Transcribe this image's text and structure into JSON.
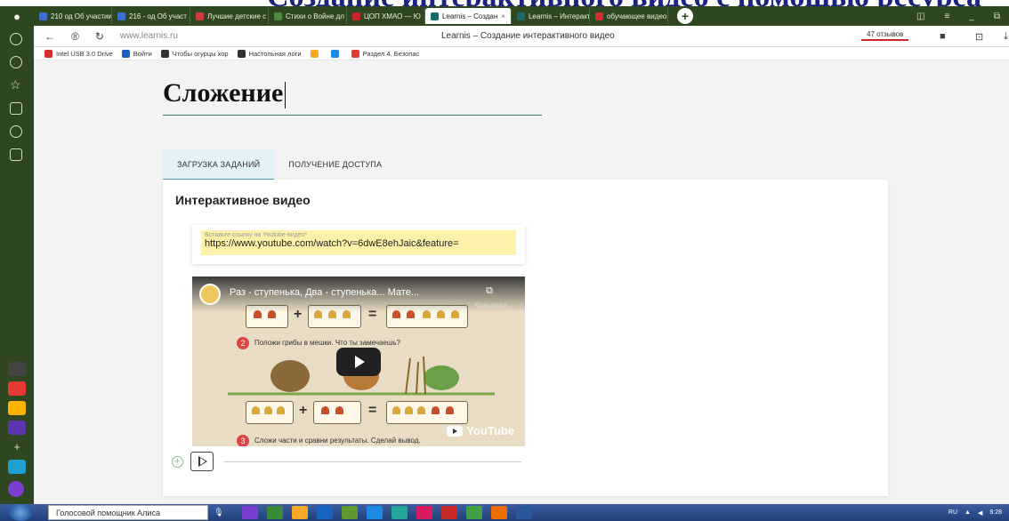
{
  "slide_header": "Создание интерактивного видео с помощью ресурса",
  "tabs": [
    {
      "label": "210 од Об участии",
      "color": "#3b6ed0"
    },
    {
      "label": "216 - од Об участ",
      "color": "#3b6ed0"
    },
    {
      "label": "Лучшие детские с",
      "color": "#d03b3b"
    },
    {
      "label": "Стихи о Войне дл",
      "color": "#4b8b3b"
    },
    {
      "label": "ЦОП ХМАО — Ю",
      "color": "#c62828"
    },
    {
      "label": "Learnis – Создан",
      "color": "#1a6a6a",
      "active": true
    },
    {
      "label": "Learnis – Интеракт",
      "color": "#1a6a6a"
    },
    {
      "label": "обучающее видео",
      "color": "#d32f2f"
    }
  ],
  "addressbar": {
    "url": "www.learnis.ru",
    "page_title": "Learnis – Создание интерактивного видео",
    "reviews": "47 отзывов"
  },
  "bookmarks": [
    {
      "label": "Intel USB 3.0 Drive",
      "color": "#d32f2f"
    },
    {
      "label": "Войти",
      "color": "#1565c0"
    },
    {
      "label": "Чтобы огурцы хор",
      "color": "#333333"
    },
    {
      "label": "Настольная логи",
      "color": "#333333"
    },
    {
      "label": "",
      "color": "#f9a825"
    },
    {
      "label": "",
      "color": "#1e88e5"
    },
    {
      "label": "Раздел 4. Безопас",
      "color": "#e53935"
    }
  ],
  "page": {
    "title": "Сложение",
    "tab_upload": "ЗАГРУЗКА ЗАДАНИЙ",
    "tab_access": "ПОЛУЧЕНИЕ ДОСТУПА",
    "card_title": "Интерактивное видео",
    "link_label": "Вставьте ссылку на Youtube-видео*",
    "link_value": "https://www.youtube.com/watch?v=6dwE8ehJaic&feature=",
    "video_title": "Раз - ступенька, Два - ступенька... Мате...",
    "video_author": "Козырева...",
    "video_task2": "Положи грибы в мешки. Что ты замечаешь?",
    "video_task3": "Сложи части и сравни результаты. Сделай вывод.",
    "video_num2": "2",
    "video_num3": "3",
    "youtube_label": "YouTube"
  },
  "taskbar": {
    "alice": "Голосовой помощник Алиса",
    "lang": "RU",
    "time": "8:28"
  }
}
